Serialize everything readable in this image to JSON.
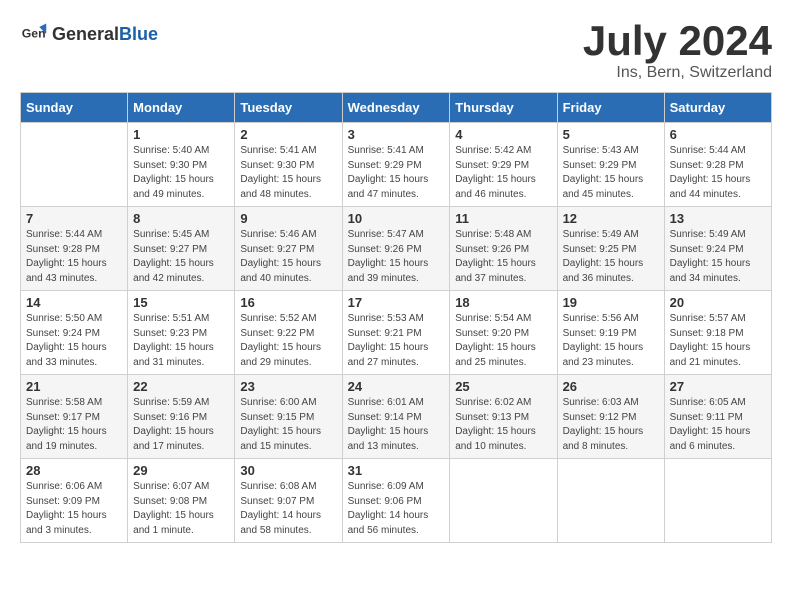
{
  "header": {
    "logo_general": "General",
    "logo_blue": "Blue",
    "month": "July 2024",
    "location": "Ins, Bern, Switzerland"
  },
  "days_of_week": [
    "Sunday",
    "Monday",
    "Tuesday",
    "Wednesday",
    "Thursday",
    "Friday",
    "Saturday"
  ],
  "weeks": [
    [
      {
        "day": "",
        "info": ""
      },
      {
        "day": "1",
        "info": "Sunrise: 5:40 AM\nSunset: 9:30 PM\nDaylight: 15 hours\nand 49 minutes."
      },
      {
        "day": "2",
        "info": "Sunrise: 5:41 AM\nSunset: 9:30 PM\nDaylight: 15 hours\nand 48 minutes."
      },
      {
        "day": "3",
        "info": "Sunrise: 5:41 AM\nSunset: 9:29 PM\nDaylight: 15 hours\nand 47 minutes."
      },
      {
        "day": "4",
        "info": "Sunrise: 5:42 AM\nSunset: 9:29 PM\nDaylight: 15 hours\nand 46 minutes."
      },
      {
        "day": "5",
        "info": "Sunrise: 5:43 AM\nSunset: 9:29 PM\nDaylight: 15 hours\nand 45 minutes."
      },
      {
        "day": "6",
        "info": "Sunrise: 5:44 AM\nSunset: 9:28 PM\nDaylight: 15 hours\nand 44 minutes."
      }
    ],
    [
      {
        "day": "7",
        "info": "Sunrise: 5:44 AM\nSunset: 9:28 PM\nDaylight: 15 hours\nand 43 minutes."
      },
      {
        "day": "8",
        "info": "Sunrise: 5:45 AM\nSunset: 9:27 PM\nDaylight: 15 hours\nand 42 minutes."
      },
      {
        "day": "9",
        "info": "Sunrise: 5:46 AM\nSunset: 9:27 PM\nDaylight: 15 hours\nand 40 minutes."
      },
      {
        "day": "10",
        "info": "Sunrise: 5:47 AM\nSunset: 9:26 PM\nDaylight: 15 hours\nand 39 minutes."
      },
      {
        "day": "11",
        "info": "Sunrise: 5:48 AM\nSunset: 9:26 PM\nDaylight: 15 hours\nand 37 minutes."
      },
      {
        "day": "12",
        "info": "Sunrise: 5:49 AM\nSunset: 9:25 PM\nDaylight: 15 hours\nand 36 minutes."
      },
      {
        "day": "13",
        "info": "Sunrise: 5:49 AM\nSunset: 9:24 PM\nDaylight: 15 hours\nand 34 minutes."
      }
    ],
    [
      {
        "day": "14",
        "info": "Sunrise: 5:50 AM\nSunset: 9:24 PM\nDaylight: 15 hours\nand 33 minutes."
      },
      {
        "day": "15",
        "info": "Sunrise: 5:51 AM\nSunset: 9:23 PM\nDaylight: 15 hours\nand 31 minutes."
      },
      {
        "day": "16",
        "info": "Sunrise: 5:52 AM\nSunset: 9:22 PM\nDaylight: 15 hours\nand 29 minutes."
      },
      {
        "day": "17",
        "info": "Sunrise: 5:53 AM\nSunset: 9:21 PM\nDaylight: 15 hours\nand 27 minutes."
      },
      {
        "day": "18",
        "info": "Sunrise: 5:54 AM\nSunset: 9:20 PM\nDaylight: 15 hours\nand 25 minutes."
      },
      {
        "day": "19",
        "info": "Sunrise: 5:56 AM\nSunset: 9:19 PM\nDaylight: 15 hours\nand 23 minutes."
      },
      {
        "day": "20",
        "info": "Sunrise: 5:57 AM\nSunset: 9:18 PM\nDaylight: 15 hours\nand 21 minutes."
      }
    ],
    [
      {
        "day": "21",
        "info": "Sunrise: 5:58 AM\nSunset: 9:17 PM\nDaylight: 15 hours\nand 19 minutes."
      },
      {
        "day": "22",
        "info": "Sunrise: 5:59 AM\nSunset: 9:16 PM\nDaylight: 15 hours\nand 17 minutes."
      },
      {
        "day": "23",
        "info": "Sunrise: 6:00 AM\nSunset: 9:15 PM\nDaylight: 15 hours\nand 15 minutes."
      },
      {
        "day": "24",
        "info": "Sunrise: 6:01 AM\nSunset: 9:14 PM\nDaylight: 15 hours\nand 13 minutes."
      },
      {
        "day": "25",
        "info": "Sunrise: 6:02 AM\nSunset: 9:13 PM\nDaylight: 15 hours\nand 10 minutes."
      },
      {
        "day": "26",
        "info": "Sunrise: 6:03 AM\nSunset: 9:12 PM\nDaylight: 15 hours\nand 8 minutes."
      },
      {
        "day": "27",
        "info": "Sunrise: 6:05 AM\nSunset: 9:11 PM\nDaylight: 15 hours\nand 6 minutes."
      }
    ],
    [
      {
        "day": "28",
        "info": "Sunrise: 6:06 AM\nSunset: 9:09 PM\nDaylight: 15 hours\nand 3 minutes."
      },
      {
        "day": "29",
        "info": "Sunrise: 6:07 AM\nSunset: 9:08 PM\nDaylight: 15 hours\nand 1 minute."
      },
      {
        "day": "30",
        "info": "Sunrise: 6:08 AM\nSunset: 9:07 PM\nDaylight: 14 hours\nand 58 minutes."
      },
      {
        "day": "31",
        "info": "Sunrise: 6:09 AM\nSunset: 9:06 PM\nDaylight: 14 hours\nand 56 minutes."
      },
      {
        "day": "",
        "info": ""
      },
      {
        "day": "",
        "info": ""
      },
      {
        "day": "",
        "info": ""
      }
    ]
  ]
}
